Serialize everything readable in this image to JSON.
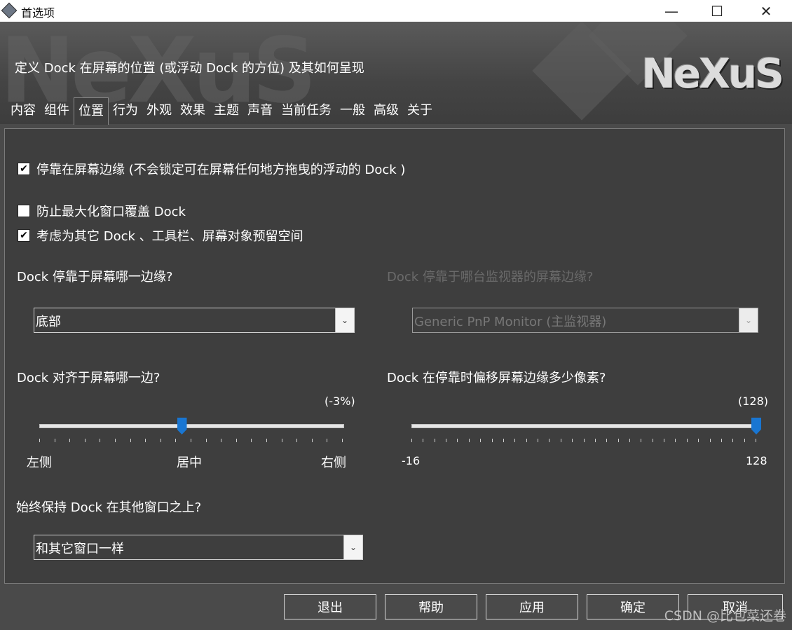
{
  "window": {
    "title": "首选项",
    "minimize_glyph": "—",
    "maximize_glyph": "☐",
    "close_glyph": "✕"
  },
  "banner": {
    "watermark": "NeXuS",
    "logo": "NeXuS",
    "caption": "定义 Dock 在屏幕的位置 (或浮动 Dock 的方位) 及其如何呈现"
  },
  "tabs": [
    "内容",
    "组件",
    "位置",
    "行为",
    "外观",
    "效果",
    "主题",
    "声音",
    "当前任务",
    "一般",
    "高级",
    "关于"
  ],
  "active_tab": "位置",
  "checkboxes": [
    {
      "label": "停靠在屏幕边缘 (不会锁定可在屏幕任何地方拖曳的浮动的 Dock )",
      "checked": true
    },
    {
      "label": "防止最大化窗口覆盖 Dock",
      "checked": false
    },
    {
      "label": "考虑为其它 Dock 、工具栏、屏幕对象预留空间",
      "checked": true
    }
  ],
  "edge": {
    "label": "Dock 停靠于屏幕哪一边缘?",
    "value": "底部"
  },
  "monitor": {
    "label": "Dock 停靠于哪台监视器的屏幕边缘?",
    "value": "Generic PnP Monitor (主监视器)",
    "enabled": false
  },
  "align": {
    "label": "Dock 对齐于屏幕哪一边?",
    "value_text": "(-3%)",
    "value": -3,
    "min_label": "左侧",
    "mid_label": "居中",
    "max_label": "右侧"
  },
  "offset": {
    "label": "Dock 在停靠时偏移屏幕边缘多少像素?",
    "value_text": "(128)",
    "value": 128,
    "min_label": "-16",
    "max_label": "128"
  },
  "ontop": {
    "label": "始终保持 Dock 在其他窗口之上?",
    "value": "和其它窗口一样"
  },
  "buttons": {
    "exit": "退出",
    "help": "帮助",
    "apply": "应用",
    "ok": "确定",
    "cancel": "取消"
  },
  "watermark_text": "CSDN @比包菜还卷",
  "colors": {
    "accent": "#1976d2",
    "background": "#4a4a4a",
    "panel": "#3e3e3e"
  }
}
